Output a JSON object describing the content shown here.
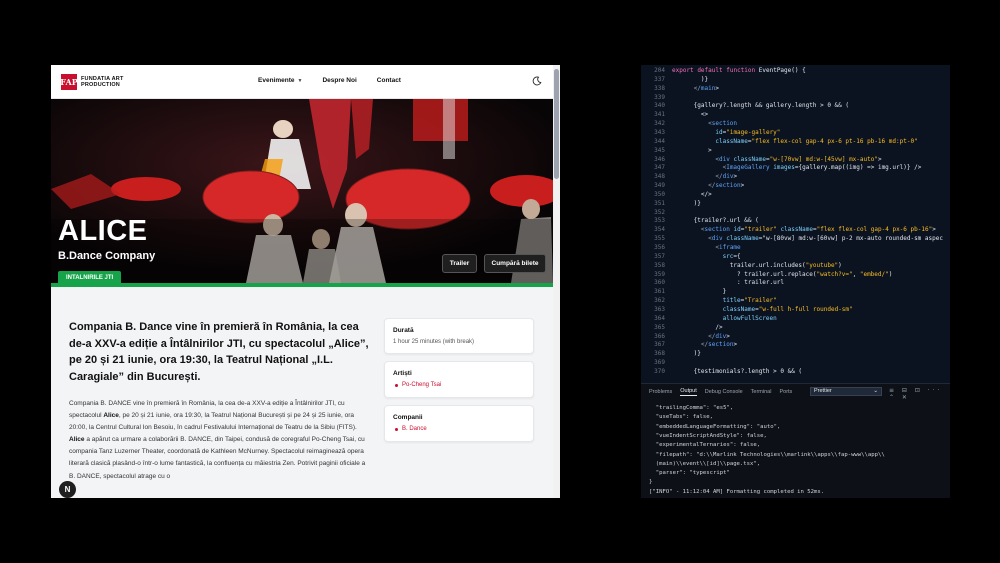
{
  "site": {
    "logo": {
      "mark": "FAP",
      "line1": "FUNDATIA ART",
      "line2": "PRODUCTION"
    },
    "nav": {
      "events": "Evenimente",
      "about": "Despre Noi",
      "contact": "Contact"
    },
    "hero": {
      "title": "ALICE",
      "subtitle": "B.Dance Company",
      "trailer_button": "Trailer",
      "tickets_button": "Cumpără bilete",
      "tag": "INTALNIRILE JTI"
    },
    "lead": "Compania B. Dance vine în premieră în România, la cea de-a XXV-a ediție a Întâlnirilor JTI, cu spectacolul „Alice”, pe 20 și 21 iunie, ora 19:30, la Teatrul Național „I.L. Caragiale” din București.",
    "body": {
      "p1_a": "Compania B. DANCE vine în premieră în România, la cea de-a XXV-a ediție a Întâlnirilor JTI, cu spectacolul ",
      "p1_bold": "Alice",
      "p1_b": ", pe 20 și 21 iunie, ora 19:30, la Teatrul Național București și pe 24 și 25 iunie, ora 20:00, la Centrul Cultural Ion Besoiu, în cadrul Festivalului Internațional de Teatru de la Sibiu (FITS).",
      "p2_bold": "Alice",
      "p2_a": " a apărut ca urmare a colaborării B. DANCE, din Taipei, condusă de coregraful Po-Cheng Tsai, cu compania Tanz Luzerner Theater, coordonată de Kathleen McNurney. Spectacolul reimaginează opera literară clasică plasând-o într-o lume fantastică, la confluența cu măiestria Zen. Potrivit paginii oficiale a B. DANCE, spectacolul atrage cu o"
    },
    "cards": {
      "duration": {
        "title": "Durată",
        "value": "1 hour 25 minutes (with break)"
      },
      "artists": {
        "title": "Artiști",
        "items": [
          "Po-Cheng Tsai"
        ]
      },
      "companies": {
        "title": "Companii",
        "items": [
          "B. Dance"
        ]
      }
    },
    "fab": "N"
  },
  "editor": {
    "lines": [
      [
        "204",
        "export default function EventPage() {"
      ],
      [
        "337",
        "        )}"
      ],
      [
        "338",
        "      </main>"
      ],
      [
        "339",
        ""
      ],
      [
        "340",
        "      {gallery?.length && gallery.length > 0 && ("
      ],
      [
        "341",
        "        <>"
      ],
      [
        "342",
        "          <section"
      ],
      [
        "343",
        "            id=\"image-gallery\""
      ],
      [
        "344",
        "            className=\"flex flex-col gap-4 px-6 pt-16 pb-16 md:pt-0\""
      ],
      [
        "345",
        "          >"
      ],
      [
        "346",
        "            <div className=\"w-[70vw] md:w-[45vw] mx-auto\">"
      ],
      [
        "347",
        "              <ImageGallery images={gallery.map((img) => img.url)} />"
      ],
      [
        "348",
        "            </div>"
      ],
      [
        "349",
        "          </section>"
      ],
      [
        "350",
        "        </>"
      ],
      [
        "351",
        "      )}"
      ],
      [
        "352",
        ""
      ],
      [
        "353",
        "      {trailer?.url && ("
      ],
      [
        "354",
        "        <section id=\"trailer\" className=\"flex flex-col gap-4 px-6 pb-16\">"
      ],
      [
        "355",
        "          <div className=\"w-[80vw] md:w-[60vw] p-2 mx-auto rounded-sm aspec"
      ],
      [
        "356",
        "            <iframe"
      ],
      [
        "357",
        "              src={"
      ],
      [
        "358",
        "                trailer.url.includes(\"youtube\")"
      ],
      [
        "359",
        "                  ? trailer.url.replace(\"watch?v=\", \"embed/\")"
      ],
      [
        "360",
        "                  : trailer.url"
      ],
      [
        "361",
        "              }"
      ],
      [
        "362",
        "              title=\"Trailer\""
      ],
      [
        "363",
        "              className=\"w-full h-full rounded-sm\""
      ],
      [
        "364",
        "              allowFullScreen"
      ],
      [
        "365",
        "            />"
      ],
      [
        "366",
        "          </div>"
      ],
      [
        "367",
        "        </section>"
      ],
      [
        "368",
        "      )}"
      ],
      [
        "369",
        ""
      ],
      [
        "370",
        "      {testimonials?.length > 0 && ("
      ]
    ],
    "panel": {
      "tabs": [
        "Problems",
        "Output",
        "Debug Console",
        "Terminal",
        "Ports"
      ],
      "active_tab": "Output",
      "dropdown": "Prettier",
      "output": [
        "  \"trailingComma\": \"es5\",",
        "  \"useTabs\": false,",
        "  \"embeddedLanguageFormatting\": \"auto\",",
        "  \"vueIndentScriptAndStyle\": false,",
        "  \"experimentalTernaries\": false,",
        "  \"filepath\": \"d:\\\\Marlink Technologies\\\\marlink\\\\apps\\\\fap-www\\\\app\\\\",
        "  (main)\\\\event\\\\[id]\\\\page.tsx\",",
        "  \"parser\": \"typescript\"",
        "}",
        "[\"INFO\" - 11:12:04 AM] Formatting completed in 52ms."
      ]
    }
  }
}
